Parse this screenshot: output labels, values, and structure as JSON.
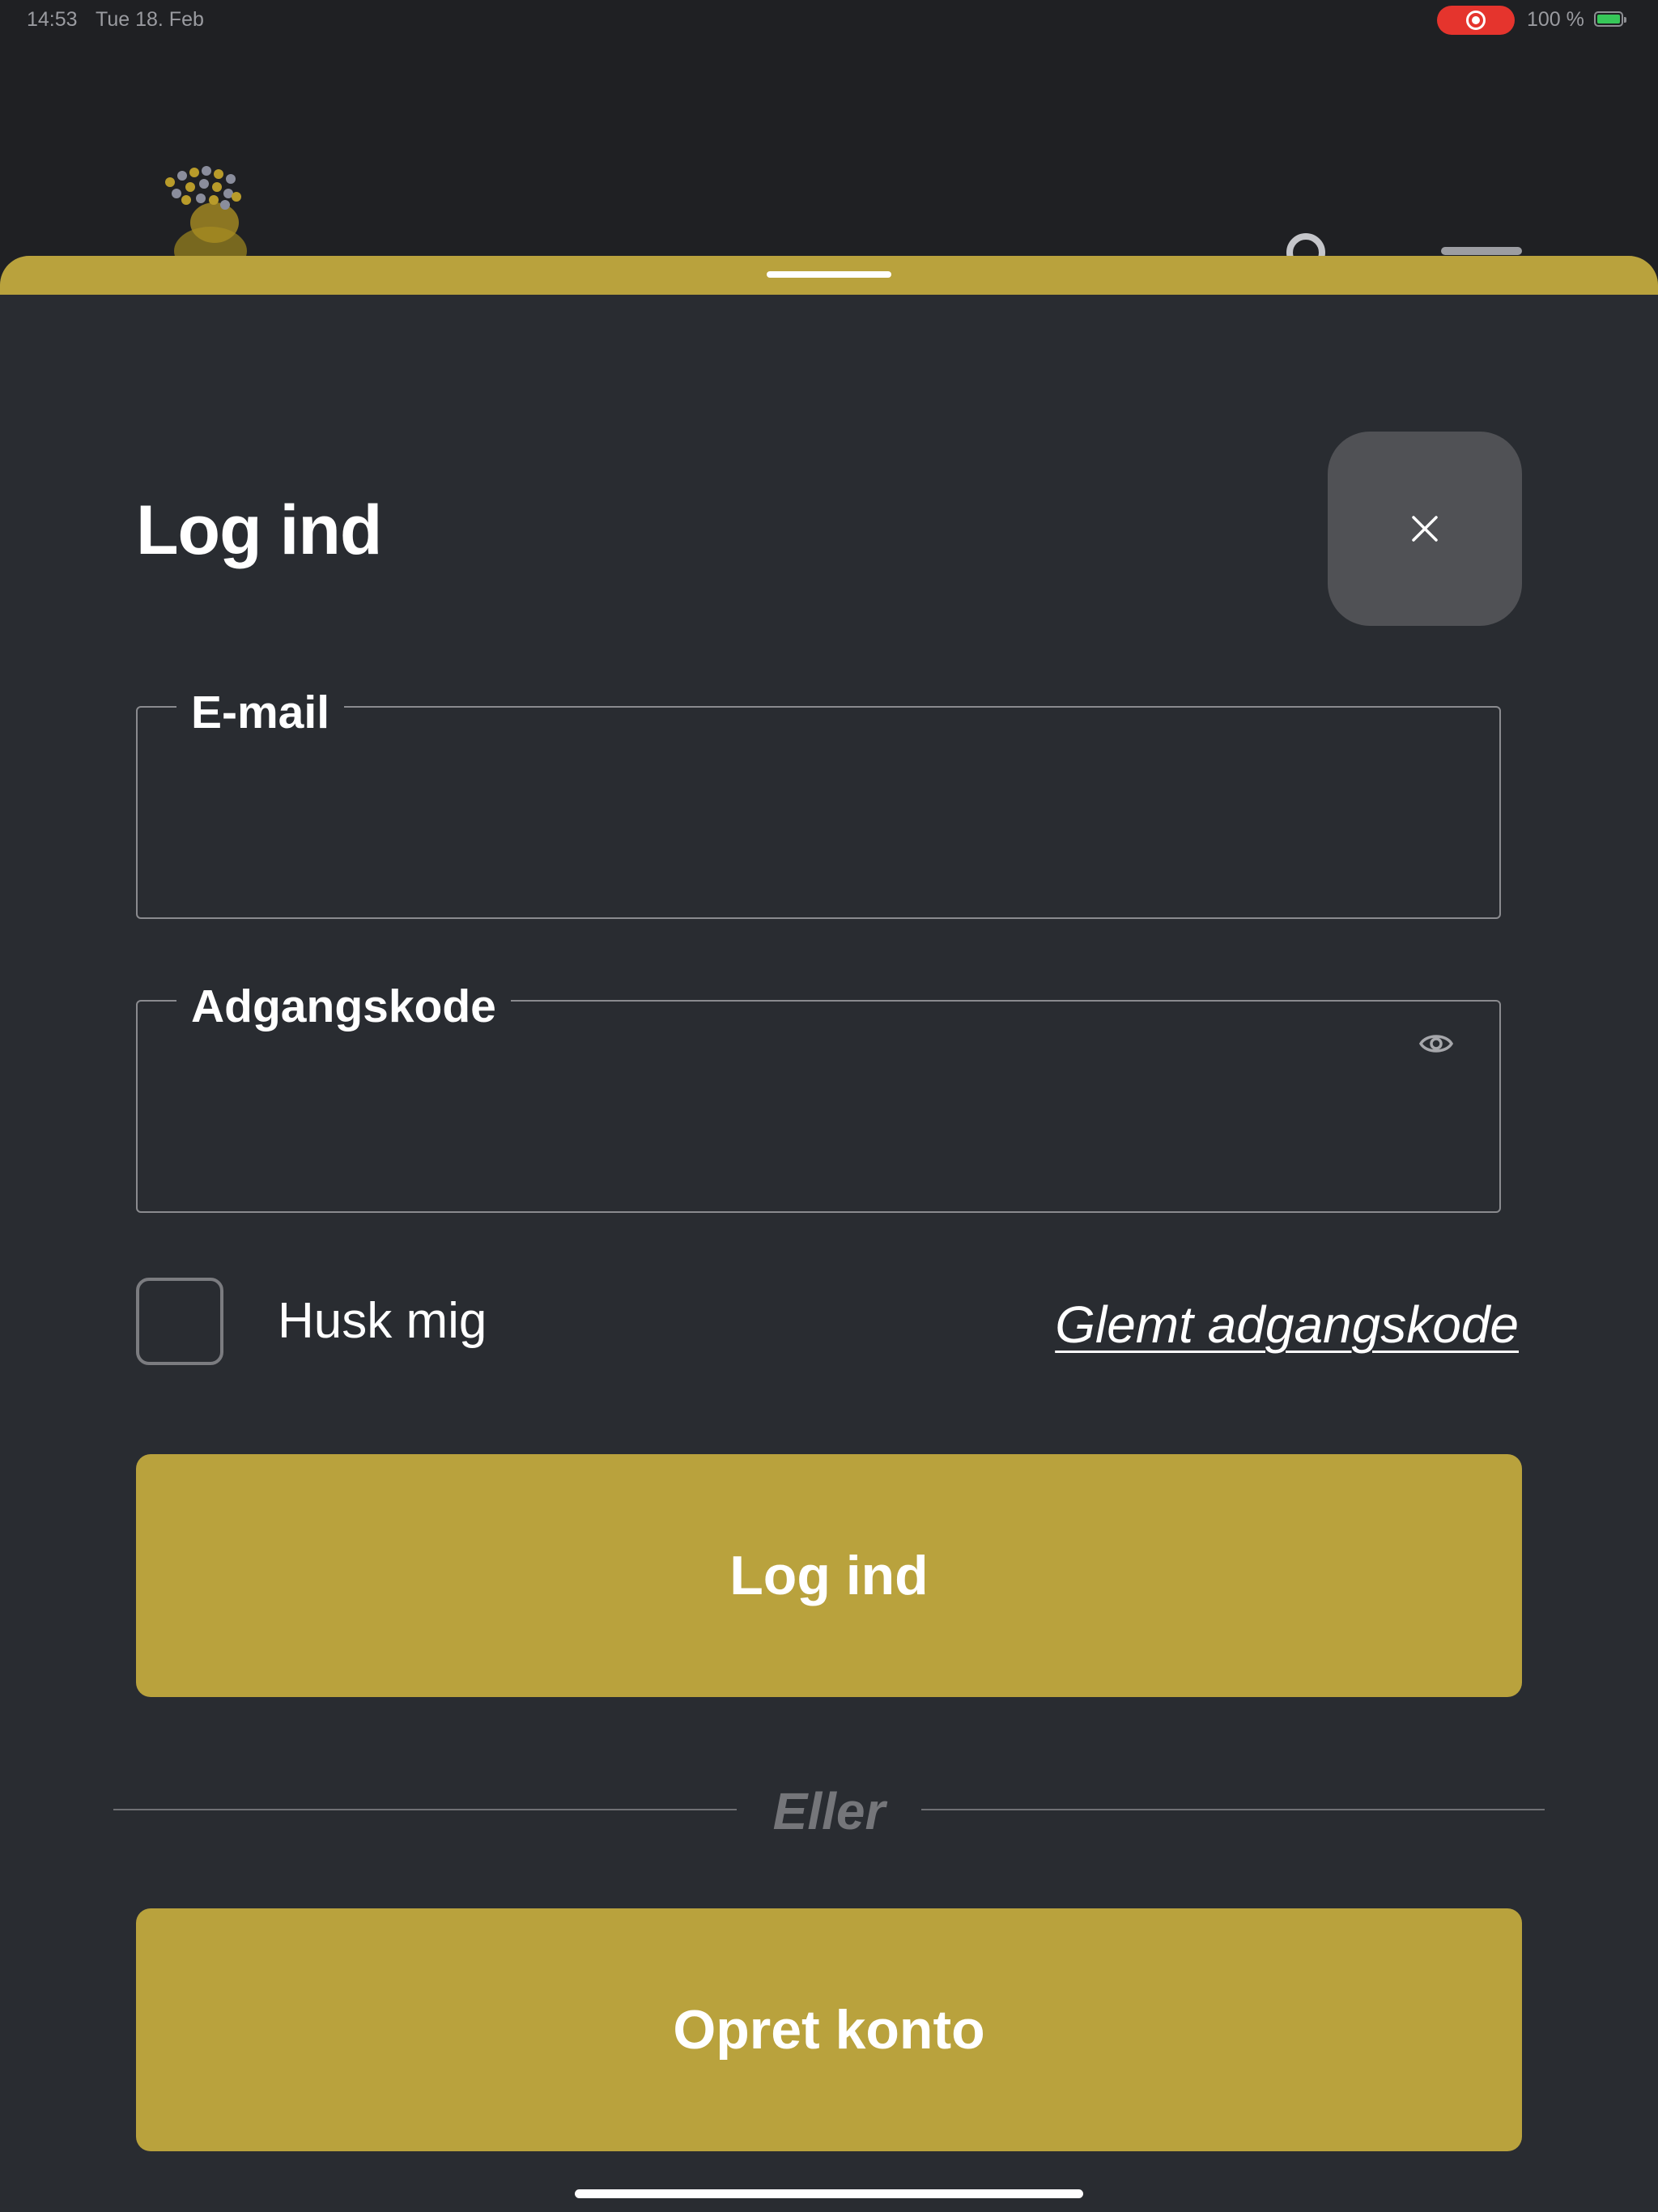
{
  "status_bar": {
    "time": "14:53",
    "date": "Tue 18. Feb",
    "battery_percent": "100 %"
  },
  "sheet": {
    "title": "Log ind",
    "close_icon": "close-icon",
    "email": {
      "label": "E-mail",
      "value": ""
    },
    "password": {
      "label": "Adgangskode",
      "value": "",
      "toggle_icon": "eye-icon"
    },
    "remember_me": {
      "label": "Husk mig",
      "checked": false
    },
    "forgot_password": "Glemt adgangskode",
    "login_button": "Log ind",
    "divider": "Eller",
    "signup_button": "Opret konto"
  },
  "colors": {
    "accent": "#b9a23d",
    "sheet_background": "#292c31",
    "close_button": "#505155",
    "recording": "#e5342d"
  }
}
